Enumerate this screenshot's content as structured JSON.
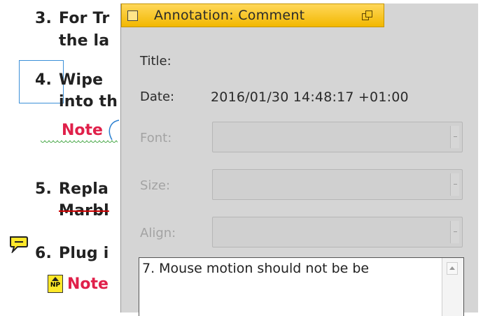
{
  "document": {
    "items": [
      {
        "number": "3.",
        "line1": "For Tr",
        "line2": "the la"
      },
      {
        "number": "4.",
        "line1": "Wipe",
        "line2": "into th",
        "note": "Note"
      },
      {
        "number": "5.",
        "line1": "Repla",
        "line2": "Marbl"
      },
      {
        "number": "6.",
        "line1": "Plug i",
        "note": "Note"
      }
    ],
    "np_icon_label": "NP"
  },
  "annotation_window": {
    "title": "Annotation: Comment",
    "fields": {
      "title_label": "Title:",
      "title_value": "",
      "date_label": "Date:",
      "date_value": "2016/01/30 14:48:17 +01:00",
      "font_label": "Font:",
      "font_value": "",
      "size_label": "Size:",
      "size_value": "",
      "align_label": "Align:",
      "align_value": ""
    },
    "comment_text": "7. Mouse motion should not be be"
  },
  "colors": {
    "titlebar": "#f2b800",
    "note_red": "#e0204a",
    "selection_blue": "#3b90d8",
    "panel_bg": "#d5d5d5"
  }
}
